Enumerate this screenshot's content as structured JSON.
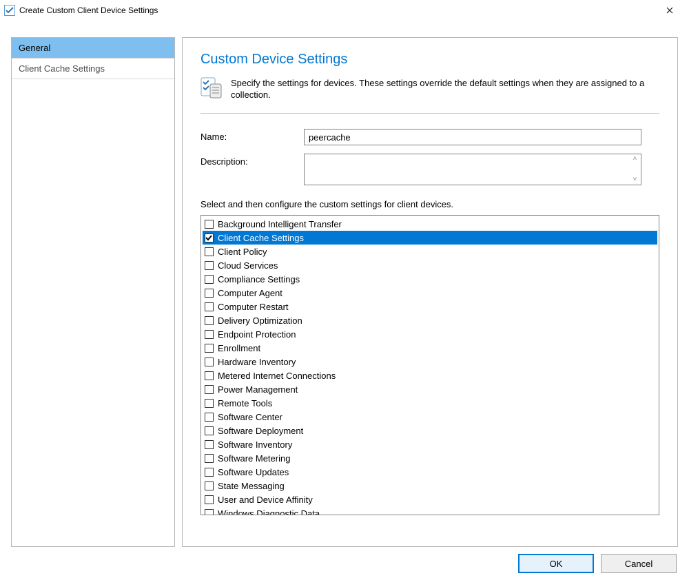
{
  "window": {
    "title": "Create Custom Client Device Settings"
  },
  "sidebar": {
    "items": [
      {
        "label": "General",
        "selected": true
      },
      {
        "label": "Client Cache Settings",
        "selected": false
      }
    ]
  },
  "content": {
    "heading": "Custom Device Settings",
    "intro": "Specify the settings for devices. These settings override the default settings when they are assigned to a collection.",
    "name_label": "Name:",
    "name_value": "peercache",
    "description_label": "Description:",
    "description_value": "",
    "instruction": "Select and then configure the custom settings for client devices.",
    "settings": [
      {
        "label": "Background Intelligent Transfer",
        "checked": false,
        "selected": false
      },
      {
        "label": "Client Cache Settings",
        "checked": true,
        "selected": true
      },
      {
        "label": "Client Policy",
        "checked": false,
        "selected": false
      },
      {
        "label": "Cloud Services",
        "checked": false,
        "selected": false
      },
      {
        "label": "Compliance Settings",
        "checked": false,
        "selected": false
      },
      {
        "label": "Computer Agent",
        "checked": false,
        "selected": false
      },
      {
        "label": "Computer Restart",
        "checked": false,
        "selected": false
      },
      {
        "label": "Delivery Optimization",
        "checked": false,
        "selected": false
      },
      {
        "label": "Endpoint Protection",
        "checked": false,
        "selected": false
      },
      {
        "label": "Enrollment",
        "checked": false,
        "selected": false
      },
      {
        "label": "Hardware Inventory",
        "checked": false,
        "selected": false
      },
      {
        "label": "Metered Internet Connections",
        "checked": false,
        "selected": false
      },
      {
        "label": "Power Management",
        "checked": false,
        "selected": false
      },
      {
        "label": "Remote Tools",
        "checked": false,
        "selected": false
      },
      {
        "label": "Software Center",
        "checked": false,
        "selected": false
      },
      {
        "label": "Software Deployment",
        "checked": false,
        "selected": false
      },
      {
        "label": "Software Inventory",
        "checked": false,
        "selected": false
      },
      {
        "label": "Software Metering",
        "checked": false,
        "selected": false
      },
      {
        "label": "Software Updates",
        "checked": false,
        "selected": false
      },
      {
        "label": "State Messaging",
        "checked": false,
        "selected": false
      },
      {
        "label": "User and Device Affinity",
        "checked": false,
        "selected": false
      },
      {
        "label": "Windows Diagnostic Data",
        "checked": false,
        "selected": false
      }
    ]
  },
  "buttons": {
    "ok": "OK",
    "cancel": "Cancel"
  }
}
